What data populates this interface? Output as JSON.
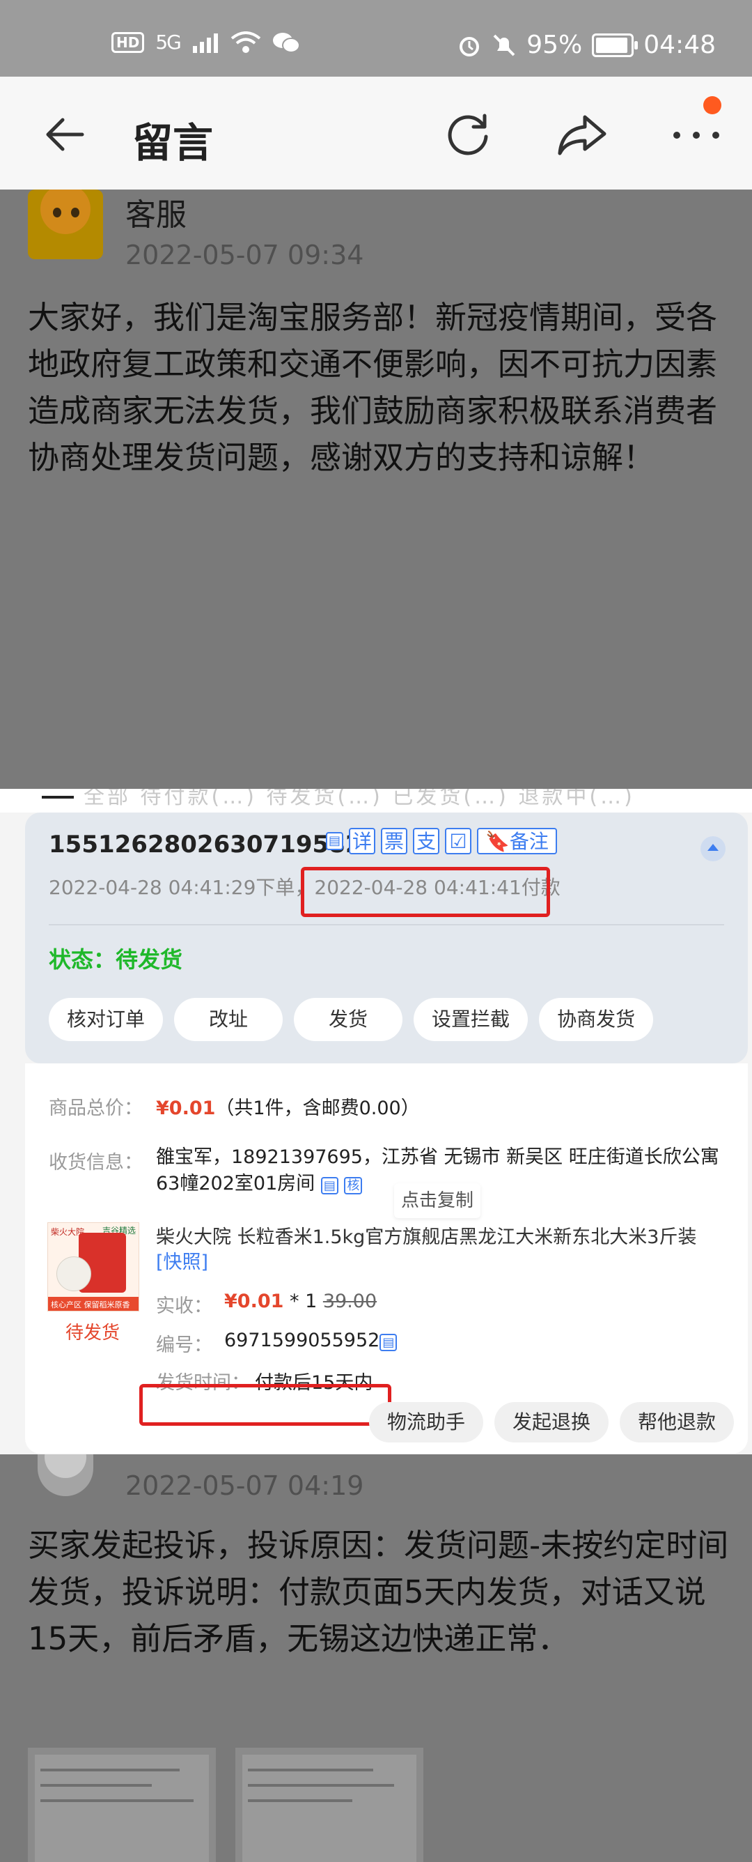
{
  "status_bar": {
    "left_icons": [
      "HD",
      "5G",
      "signal-icon",
      "wifi-icon",
      "wechat-icon"
    ],
    "right_icons": [
      "alarm-icon",
      "mute-icon"
    ],
    "battery": "95%",
    "battery_level": 0.95,
    "time": "04:48"
  },
  "nav": {
    "title": "留言"
  },
  "message1": {
    "name": "客服",
    "time": "2022-05-07 09:34",
    "text": "大家好，我们是淘宝服务部！新冠疫情期间，受各地政府复工政策和交通不便影响，因不可抗力因素造成商家无法发货，我们鼓励商家积极联系消费者协商处理发货问题，感谢双方的支持和谅解！"
  },
  "order": {
    "top_strip_text": "全部 待付款(…) 待发货(…) 已发货(…) 退款中(…)",
    "order_no": "1551262802630719582",
    "tags": [
      "详",
      "票",
      "支"
    ],
    "copy_icon": "copy-icon",
    "check_icon": "check-icon",
    "note_label": "备注",
    "order_time": "2022-04-28 04:41:29下单，",
    "pay_time": "2022-04-28 04:41:41付款",
    "status_label": "状态：",
    "status_value": "待发货",
    "actions": [
      "核对订单",
      "改址",
      "发货",
      "设置拦截",
      "协商发货"
    ],
    "total_label": "商品总价：",
    "total_price": "¥0.01",
    "total_note": "（共1件，含邮费0.00）",
    "receiver_label": "收货信息：",
    "receiver_value": "雒宝军，18921397695，江苏省 无锡市 新吴区 旺庄街道长欣公寓63幢202室01房间",
    "verify_tag": "核",
    "tooltip": "点击复制",
    "product_title": "柴火大院 长粒香米1.5kg官方旗舰店黑龙江大米新东北大米3斤装",
    "snapshot": "[快照]",
    "product_image_brand": "柴火大院",
    "product_image_tag": "吉谷精选",
    "product_image_footer": "核心产区 保留稻米原香",
    "product_status": "待发货",
    "paid_label": "实收：",
    "paid_price": "¥0.01",
    "paid_qty": "* 1",
    "paid_orig": "39.00",
    "code_label": "编号：",
    "code_value": "6971599055952",
    "ship_label": "发货时间：",
    "ship_value": "付款后15天内",
    "bottom_actions": [
      "物流助手",
      "发起退换",
      "帮他退款"
    ]
  },
  "message2": {
    "time": "2022-05-07 04:19",
    "text": "买家发起投诉，投诉原因：发货问题-未按约定时间发货，投诉说明：付款页面5天内发货，对话又说15天，前后矛盾，无锡这边快递正常．"
  },
  "colors": {
    "accent_blue": "#3d7df0",
    "status_green": "#1fb82a",
    "price_red": "#e4462c",
    "highlight_red": "#e02020",
    "notification_dot": "#ff5a1f"
  }
}
